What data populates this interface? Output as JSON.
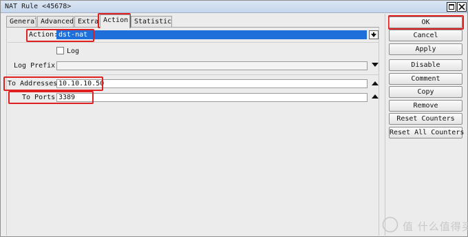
{
  "window": {
    "title": "NAT Rule <45678>"
  },
  "tabs": [
    {
      "label": "General"
    },
    {
      "label": "Advanced"
    },
    {
      "label": "Extra"
    },
    {
      "label": "Action"
    },
    {
      "label": "Statistics"
    }
  ],
  "active_tab": "Action",
  "form": {
    "action": {
      "label": "Action:",
      "value": "dst-nat"
    },
    "log": {
      "label": "Log",
      "checked": false
    },
    "log_prefix": {
      "label": "Log Prefix:",
      "value": ""
    },
    "to_addresses": {
      "label": "To Addresses:",
      "value": "10.10.10.50"
    },
    "to_ports": {
      "label": "To Ports:",
      "value": "3389"
    }
  },
  "buttons": {
    "ok": "OK",
    "cancel": "Cancel",
    "apply": "Apply",
    "disable": "Disable",
    "comment": "Comment",
    "copy": "Copy",
    "remove": "Remove",
    "reset_counters": "Reset Counters",
    "reset_all_counters": "Reset All Counters"
  },
  "watermark": {
    "text": "值 什么值得买"
  },
  "colors": {
    "highlight_box": "#e02020",
    "selection": "#1e6fd9",
    "titlebar": "#c5d6ec"
  }
}
